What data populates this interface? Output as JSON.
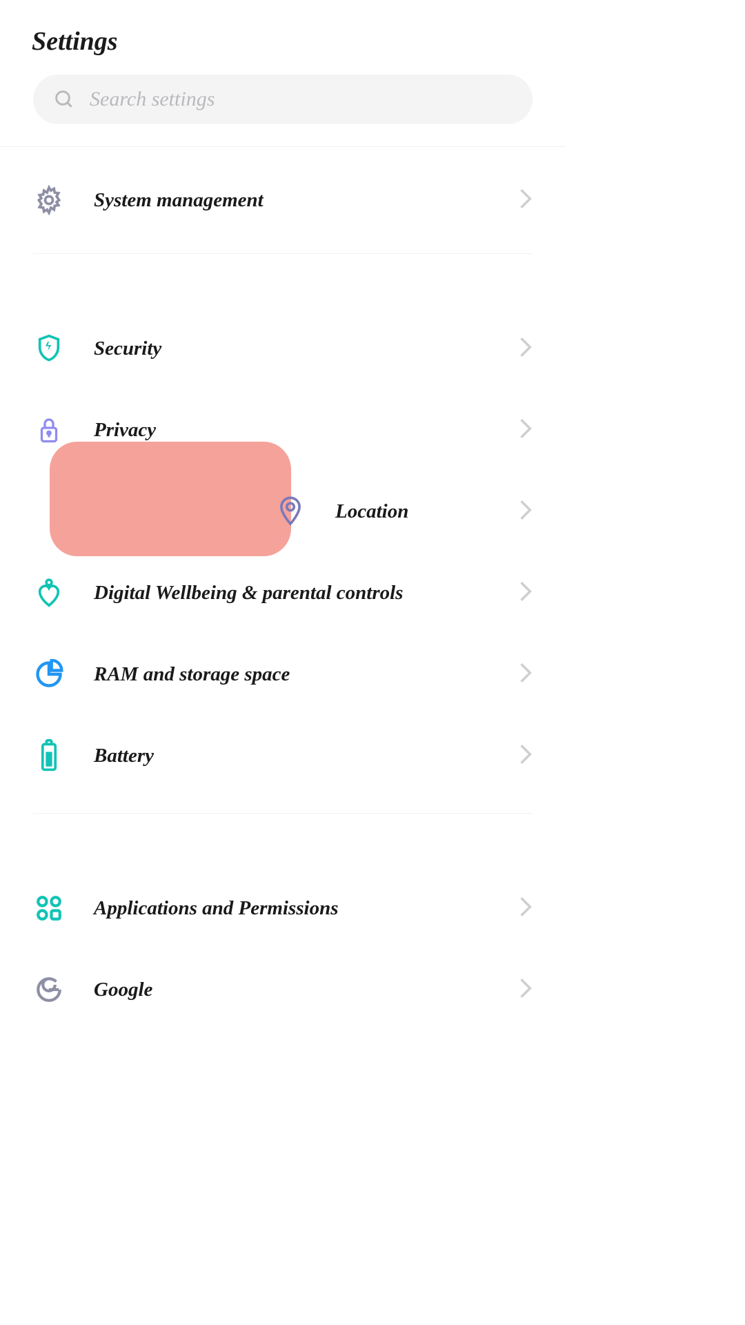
{
  "header": {
    "title": "Settings"
  },
  "search": {
    "placeholder": "Search settings"
  },
  "section1": {
    "system_management": {
      "label": "System management",
      "icon_color": "#8e8fa5"
    }
  },
  "section2": {
    "security": {
      "label": "Security",
      "icon_color": "#11c3b5"
    },
    "privacy": {
      "label": "Privacy",
      "icon_color": "#8f8cf0"
    },
    "location": {
      "label": "Location",
      "icon_color": "#7a7ab8",
      "highlighted": true
    },
    "digital_wellbeing": {
      "label": "Digital Wellbeing & parental controls",
      "icon_color": "#11c3b5"
    },
    "ram_storage": {
      "label": "RAM and storage space",
      "icon_color": "#2196f3"
    },
    "battery": {
      "label": "Battery",
      "icon_color": "#11c3b5"
    }
  },
  "section3": {
    "apps_permissions": {
      "label": "Applications and Permissions",
      "icon_color": "#11c3b5"
    },
    "google": {
      "label": "Google",
      "icon_color": "#8e8fa5"
    }
  },
  "colors": {
    "highlight": "#f28b82",
    "chevron": "#cfcfd3"
  }
}
